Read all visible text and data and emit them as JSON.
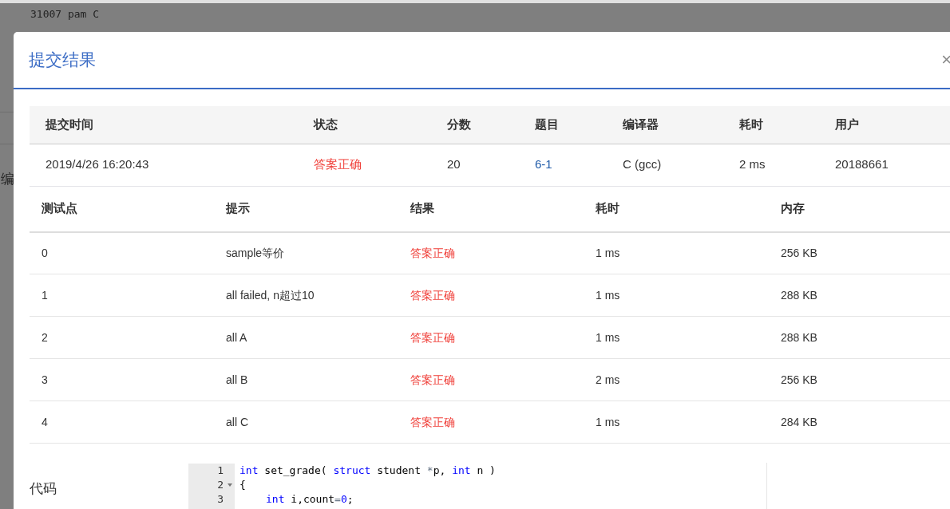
{
  "background": {
    "code_lines": [
      "31007 pam C"
    ],
    "side_text": "编"
  },
  "modal": {
    "title": "提交结果",
    "close": "×",
    "summary": {
      "columns": [
        "提交时间",
        "状态",
        "分数",
        "题目",
        "编译器",
        "耗时",
        "用户"
      ],
      "row": {
        "time": "2019/4/26 16:20:43",
        "status": "答案正确",
        "score": "20",
        "problem": "6-1",
        "compiler": "C (gcc)",
        "duration": "2 ms",
        "user": "20188661"
      }
    },
    "tests": {
      "columns": [
        "测试点",
        "提示",
        "结果",
        "耗时",
        "内存"
      ],
      "rows": [
        {
          "cells": [
            "0",
            "sample等价",
            "答案正确",
            "1 ms",
            "256 KB"
          ]
        },
        {
          "cells": [
            "1",
            "all failed, n超过10",
            "答案正确",
            "1 ms",
            "288 KB"
          ]
        },
        {
          "cells": [
            "2",
            "all A",
            "答案正确",
            "1 ms",
            "288 KB"
          ]
        },
        {
          "cells": [
            "3",
            "all B",
            "答案正确",
            "2 ms",
            "256 KB"
          ]
        },
        {
          "cells": [
            "4",
            "all C",
            "答案正确",
            "1 ms",
            "284 KB"
          ]
        }
      ]
    },
    "code": {
      "label": "代码",
      "lines": [
        {
          "number": "1",
          "foldable": false,
          "indented": false,
          "tokens": [
            {
              "kind": "keyword",
              "text": "int"
            },
            {
              "kind": "plain",
              "text": " set_grade( "
            },
            {
              "kind": "keyword",
              "text": "struct"
            },
            {
              "kind": "plain",
              "text": " student "
            },
            {
              "kind": "operator",
              "text": "*"
            },
            {
              "kind": "plain",
              "text": "p, "
            },
            {
              "kind": "keyword",
              "text": "int"
            },
            {
              "kind": "plain",
              "text": " n )"
            }
          ]
        },
        {
          "number": "2",
          "foldable": true,
          "indented": false,
          "tokens": [
            {
              "kind": "plain",
              "text": "{"
            }
          ]
        },
        {
          "number": "3",
          "foldable": false,
          "indented": true,
          "tokens": [
            {
              "kind": "keyword",
              "text": "int"
            },
            {
              "kind": "plain",
              "text": " i,count"
            },
            {
              "kind": "operator",
              "text": "="
            },
            {
              "kind": "number",
              "text": "0"
            },
            {
              "kind": "plain",
              "text": ";"
            }
          ]
        }
      ]
    }
  }
}
